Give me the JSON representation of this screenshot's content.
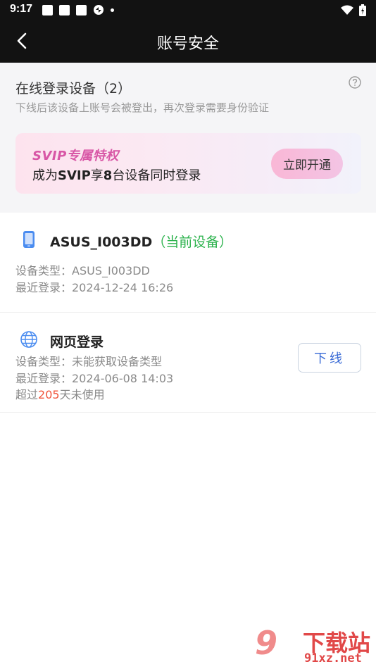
{
  "status_bar": {
    "time": "9:17"
  },
  "header": {
    "title": "账号安全",
    "back_icon": "back-arrow-icon"
  },
  "online_section": {
    "title": "在线登录设备（2）",
    "subtitle": "下线后该设备上账号会被登出，再次登录需要身份验证",
    "help_icon": "question-circle-icon"
  },
  "banner": {
    "tag": "SVIP专属特权",
    "text_before": "成为",
    "text_svip": "SVIP",
    "text_mid": "享",
    "text_num": "8",
    "text_after": "台设备同时登录",
    "button": "立即开通",
    "colors": {
      "tag": "#d857a6",
      "button": "#f9b7d6"
    }
  },
  "devices": [
    {
      "icon": "phone-icon",
      "name": "ASUS_I003DD",
      "current_tag": "（当前设备）",
      "type_line": "设备类型：ASUS_I003DD",
      "last_login": "最近登录：2024-12-24 16:26"
    },
    {
      "icon": "globe-icon",
      "name": "网页登录",
      "type_line": "设备类型：未能获取设备类型",
      "last_login": "最近登录：2024-06-08 14:03",
      "unused_before": "超过",
      "unused_days": "205",
      "unused_after": "天未使用",
      "logout_button": "下线"
    }
  ],
  "watermark": {
    "logo_text": "9",
    "brand": "下载站",
    "site": "91xz.net"
  },
  "colors": {
    "header_bg": "#121212",
    "current_green": "#2bb24c",
    "days_red": "#f0533a",
    "logout_blue": "#3a6bd6"
  }
}
